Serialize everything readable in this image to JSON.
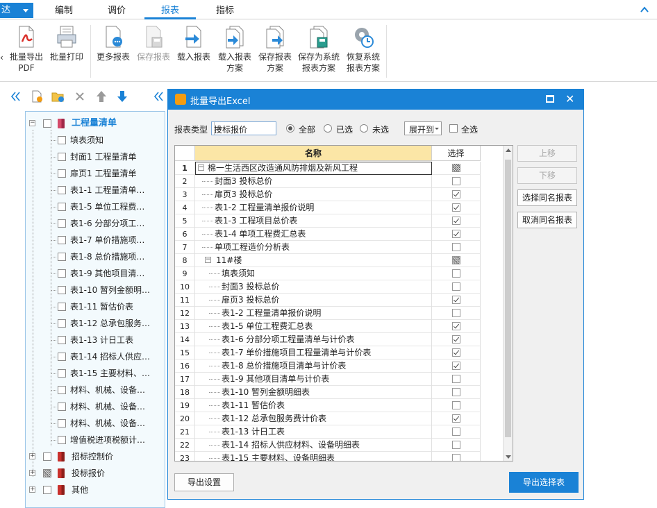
{
  "menubar": {
    "app_label": "达",
    "tabs": [
      {
        "label": "编制"
      },
      {
        "label": "调价"
      },
      {
        "label": "报表"
      },
      {
        "label": "指标"
      }
    ],
    "active_tab": "报表"
  },
  "ribbon": {
    "items": [
      {
        "line1": "批量导出",
        "line2": "PDF",
        "icon": "pdf-export-icon"
      },
      {
        "line1": "批量打印",
        "line2": "",
        "icon": "batch-print-icon"
      },
      {
        "line1": "更多报表",
        "line2": "",
        "icon": "more-reports-icon"
      },
      {
        "line1": "保存报表",
        "line2": "",
        "icon": "save-report-icon",
        "disabled": true
      },
      {
        "line1": "载入报表",
        "line2": "",
        "icon": "load-report-icon"
      },
      {
        "line1": "载入报表",
        "line2": "方案",
        "icon": "load-scheme-icon"
      },
      {
        "line1": "保存报表",
        "line2": "方案",
        "icon": "save-scheme-icon"
      },
      {
        "line1": "保存为系统",
        "line2": "报表方案",
        "icon": "save-system-scheme-icon"
      },
      {
        "line1": "恢复系统",
        "line2": "报表方案",
        "icon": "restore-system-scheme-icon"
      }
    ]
  },
  "left_tree": {
    "root": "工程量清单",
    "children": [
      "填表须知",
      "封面1 工程量清单",
      "扉页1 工程量清单",
      "表1-1 工程量清单…",
      "表1-5 单位工程费…",
      "表1-6 分部分项工…",
      "表1-7 单价措施项…",
      "表1-8 总价措施项…",
      "表1-9 其他项目清…",
      "表1-10 暂列金额明…",
      "表1-11 暂估价表",
      "表1-12 总承包服务…",
      "表1-13 计日工表",
      "表1-14 招标人供应…",
      "表1-15 主要材料、…",
      "材料、机械、设备…",
      "材料、机械、设备…",
      "材料、机械、设备…",
      "增值税进项税额计…"
    ],
    "siblings": [
      "招标控制价",
      "投标报价",
      "其他"
    ]
  },
  "dialog": {
    "title": "批量导出Excel",
    "type_label": "报表类型",
    "type_value": "投标报价",
    "radio_all": "全部",
    "radio_selected": "已选",
    "radio_unselected": "未选",
    "expand_label": "展开到",
    "select_all_label": "全选",
    "col_name": "名称",
    "col_select": "选择",
    "rows": [
      {
        "n": "1",
        "name": "棉一生活西区改造通风防排烟及新风工程",
        "state": "partial"
      },
      {
        "n": "2",
        "name": "封面3 投标总价",
        "state": "unchecked"
      },
      {
        "n": "3",
        "name": "扉页3 投标总价",
        "state": "checked"
      },
      {
        "n": "4",
        "name": "表1-2 工程量清单报价说明",
        "state": "checked"
      },
      {
        "n": "5",
        "name": "表1-3 工程项目总价表",
        "state": "checked"
      },
      {
        "n": "6",
        "name": "表1-4 单项工程费汇总表",
        "state": "checked"
      },
      {
        "n": "7",
        "name": "单项工程造价分析表",
        "state": "unchecked"
      },
      {
        "n": "8",
        "name": "11#楼",
        "state": "partial"
      },
      {
        "n": "9",
        "name": "填表须知",
        "state": "unchecked"
      },
      {
        "n": "10",
        "name": "封面3 投标总价",
        "state": "unchecked"
      },
      {
        "n": "11",
        "name": "扉页3 投标总价",
        "state": "checked"
      },
      {
        "n": "12",
        "name": "表1-2 工程量清单报价说明",
        "state": "unchecked"
      },
      {
        "n": "13",
        "name": "表1-5 单位工程费汇总表",
        "state": "checked"
      },
      {
        "n": "14",
        "name": "表1-6 分部分项工程量清单与计价表",
        "state": "checked"
      },
      {
        "n": "15",
        "name": "表1-7 单价措施项目工程量清单与计价表",
        "state": "checked"
      },
      {
        "n": "16",
        "name": "表1-8 总价措施项目清单与计价表",
        "state": "checked"
      },
      {
        "n": "17",
        "name": "表1-9 其他项目清单与计价表",
        "state": "unchecked"
      },
      {
        "n": "18",
        "name": "表1-10 暂列金额明细表",
        "state": "unchecked"
      },
      {
        "n": "19",
        "name": "表1-11 暂估价表",
        "state": "unchecked"
      },
      {
        "n": "20",
        "name": "表1-12 总承包服务费计价表",
        "state": "checked"
      },
      {
        "n": "21",
        "name": "表1-13 计日工表",
        "state": "unchecked"
      },
      {
        "n": "22",
        "name": "表1-14 招标人供应材料、设备明细表",
        "state": "unchecked"
      },
      {
        "n": "23",
        "name": "表1-15 主要材料、设备明细表",
        "state": "unchecked"
      }
    ],
    "btn_up": "上移",
    "btn_down": "下移",
    "btn_select_same": "选择同名报表",
    "btn_cancel_same": "取消同名报表",
    "btn_export_settings": "导出设置",
    "btn_export_selected": "导出选择表"
  },
  "colors": {
    "accent": "#1a82d6",
    "header_highlight": "#fbe6a6",
    "tree_bg": "#f3fafd"
  }
}
